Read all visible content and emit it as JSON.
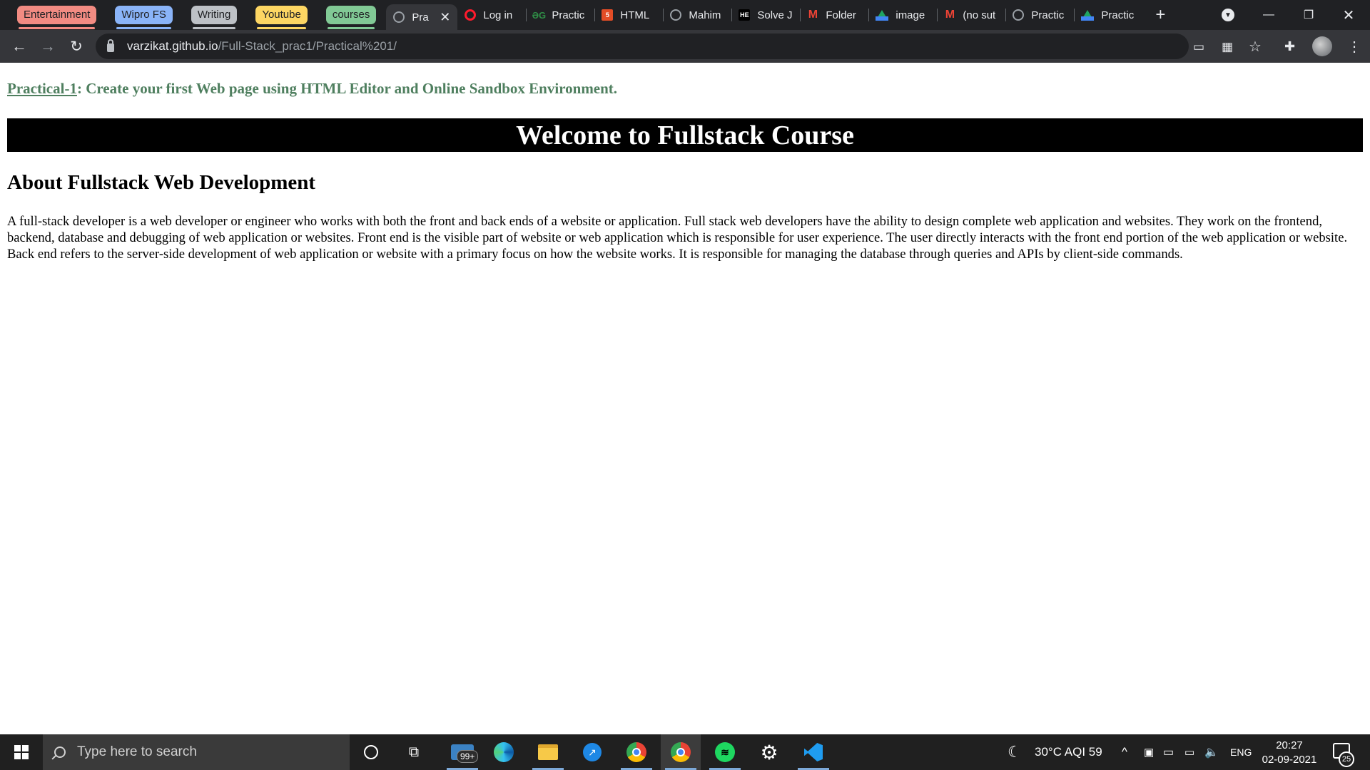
{
  "browser": {
    "tab_groups": [
      {
        "label": "Entertainment",
        "color": "#f28b82"
      },
      {
        "label": "Wipro FS",
        "color": "#8ab4f8"
      },
      {
        "label": "Writing",
        "color": "#bdc1c6"
      },
      {
        "label": "Youtube",
        "color": "#fdd663"
      },
      {
        "label": "courses",
        "color": "#81c995"
      }
    ],
    "tabs": [
      {
        "label": "Pra",
        "icon": "globe-icon"
      },
      {
        "label": "Log in",
        "icon": "opera-icon"
      },
      {
        "label": "Practic",
        "icon": "geeksforgeeks-icon"
      },
      {
        "label": "HTML",
        "icon": "html-icon"
      },
      {
        "label": "Mahim",
        "icon": "globe-icon"
      },
      {
        "label": "Solve J",
        "icon": "hackerearth-icon"
      },
      {
        "label": "Folder",
        "icon": "gmail-icon"
      },
      {
        "label": "image",
        "icon": "google-drive-icon"
      },
      {
        "label": "(no sut",
        "icon": "gmail-icon"
      },
      {
        "label": "Practic",
        "icon": "globe-icon"
      },
      {
        "label": "Practic",
        "icon": "google-drive-icon"
      }
    ],
    "url_host": "varzikat.github.io",
    "url_path": "/Full-Stack_prac1/Practical%201/"
  },
  "page": {
    "practical_link": "Practical-1",
    "practical_rest": ": Create your first Web page using HTML Editor and Online Sandbox Environment.",
    "banner_title": "Welcome to Fullstack Course",
    "about_heading": "About Fullstack Web Development",
    "about_text": "A full-stack developer is a web developer or engineer who works with both the front and back ends of a website or application. Full stack web developers have the ability to design complete web application and websites. They work on the frontend, backend, database and debugging of web application or websites. Front end is the visible part of website or web application which is responsible for user experience. The user directly interacts with the front end portion of the web application or website. Back end refers to the server-side development of web application or website with a primary focus on how the website works. It is responsible for managing the database through queries and APIs by client-side commands."
  },
  "taskbar": {
    "search_placeholder": "Type here to search",
    "mail_badge": "99+",
    "weather": "30°C  AQI 59",
    "language": "ENG",
    "time": "20:27",
    "date": "02-09-2021",
    "notification_count": "25"
  }
}
